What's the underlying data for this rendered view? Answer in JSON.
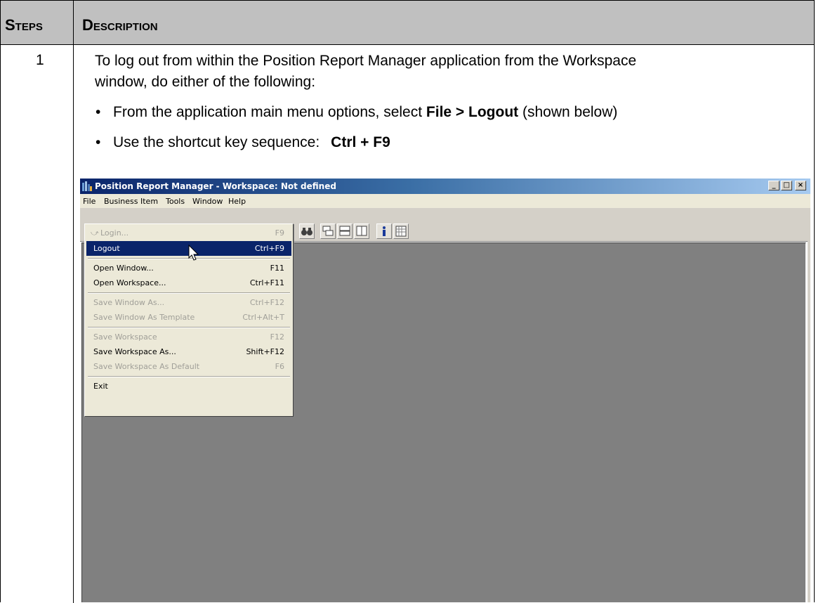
{
  "table": {
    "header_steps": "Steps",
    "header_description": "Description",
    "step_number": "1",
    "intro_line1": "To log out from within the Position Report Manager application from the Workspace",
    "intro_line2": "window, do either of the following:",
    "bullet1_pre": "From the application main menu options, select ",
    "bullet1_bold": "File > Logout",
    "bullet1_post": " (shown below)",
    "bullet2_pre": "Use the shortcut key sequence:",
    "bullet2_bold": "Ctrl + F9",
    "bullet_glyph": "•"
  },
  "window": {
    "title": "Position Report Manager - Workspace: Not defined",
    "title_color": "#0a246a",
    "controls": {
      "minimize": "_",
      "maximize": "□",
      "close": "×"
    },
    "menubar": [
      "File",
      "Business Item",
      "Tools",
      "Window",
      "Help"
    ],
    "workspace_color": "#808080"
  },
  "file_menu": {
    "items": [
      {
        "label": "Login...",
        "shortcut": "F9",
        "disabled": true
      },
      {
        "label": "Logout",
        "shortcut": "Ctrl+F9",
        "selected": true
      },
      {
        "label": "Open Window...",
        "shortcut": "F11"
      },
      {
        "label": "Open Workspace...",
        "shortcut": "Ctrl+F11"
      },
      {
        "label": "Save Window As...",
        "shortcut": "Ctrl+F12",
        "disabled": true
      },
      {
        "label": "Save Window As Template",
        "shortcut": "Ctrl+Alt+T",
        "disabled": true
      },
      {
        "label": "Save Workspace",
        "shortcut": "F12",
        "disabled": true
      },
      {
        "label": "Save Workspace As...",
        "shortcut": "Shift+F12"
      },
      {
        "label": "Save Workspace As Default",
        "shortcut": "F6",
        "disabled": true
      },
      {
        "label": "Exit",
        "shortcut": ""
      }
    ]
  }
}
